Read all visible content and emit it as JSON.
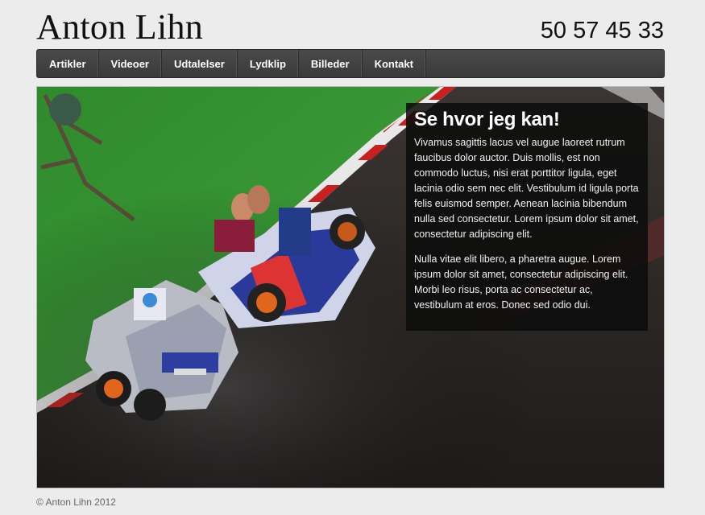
{
  "header": {
    "title": "Anton Lihn",
    "phone": "50 57 45 33"
  },
  "nav": {
    "items": [
      "Artikler",
      "Videoer",
      "Udtalelser",
      "Lydklip",
      "Billeder",
      "Kontakt"
    ]
  },
  "hero": {
    "image_icon": "rc-car-photo",
    "heading": "Se hvor jeg kan!",
    "paragraphs": [
      "Vivamus sagittis lacus vel augue laoreet rutrum faucibus dolor auctor. Duis mollis, est non commodo luctus, nisi erat porttitor ligula, eget lacinia odio sem nec elit. Vestibulum id ligula porta felis euismod semper. Aenean lacinia bibendum nulla sed consectetur. Lorem ipsum dolor sit amet, consectetur adipiscing elit.",
      "Nulla vitae elit libero, a pharetra augue. Lorem ipsum dolor sit amet, consectetur adipiscing elit. Morbi leo risus, porta ac consectetur ac, vestibulum at eros. Donec sed odio dui."
    ]
  },
  "footer": {
    "copyright": "© Anton Lihn 2012"
  },
  "colors": {
    "navbar": "#3f3f3f",
    "page_background": "#ececec",
    "caption_background": "#0c0c0c"
  }
}
